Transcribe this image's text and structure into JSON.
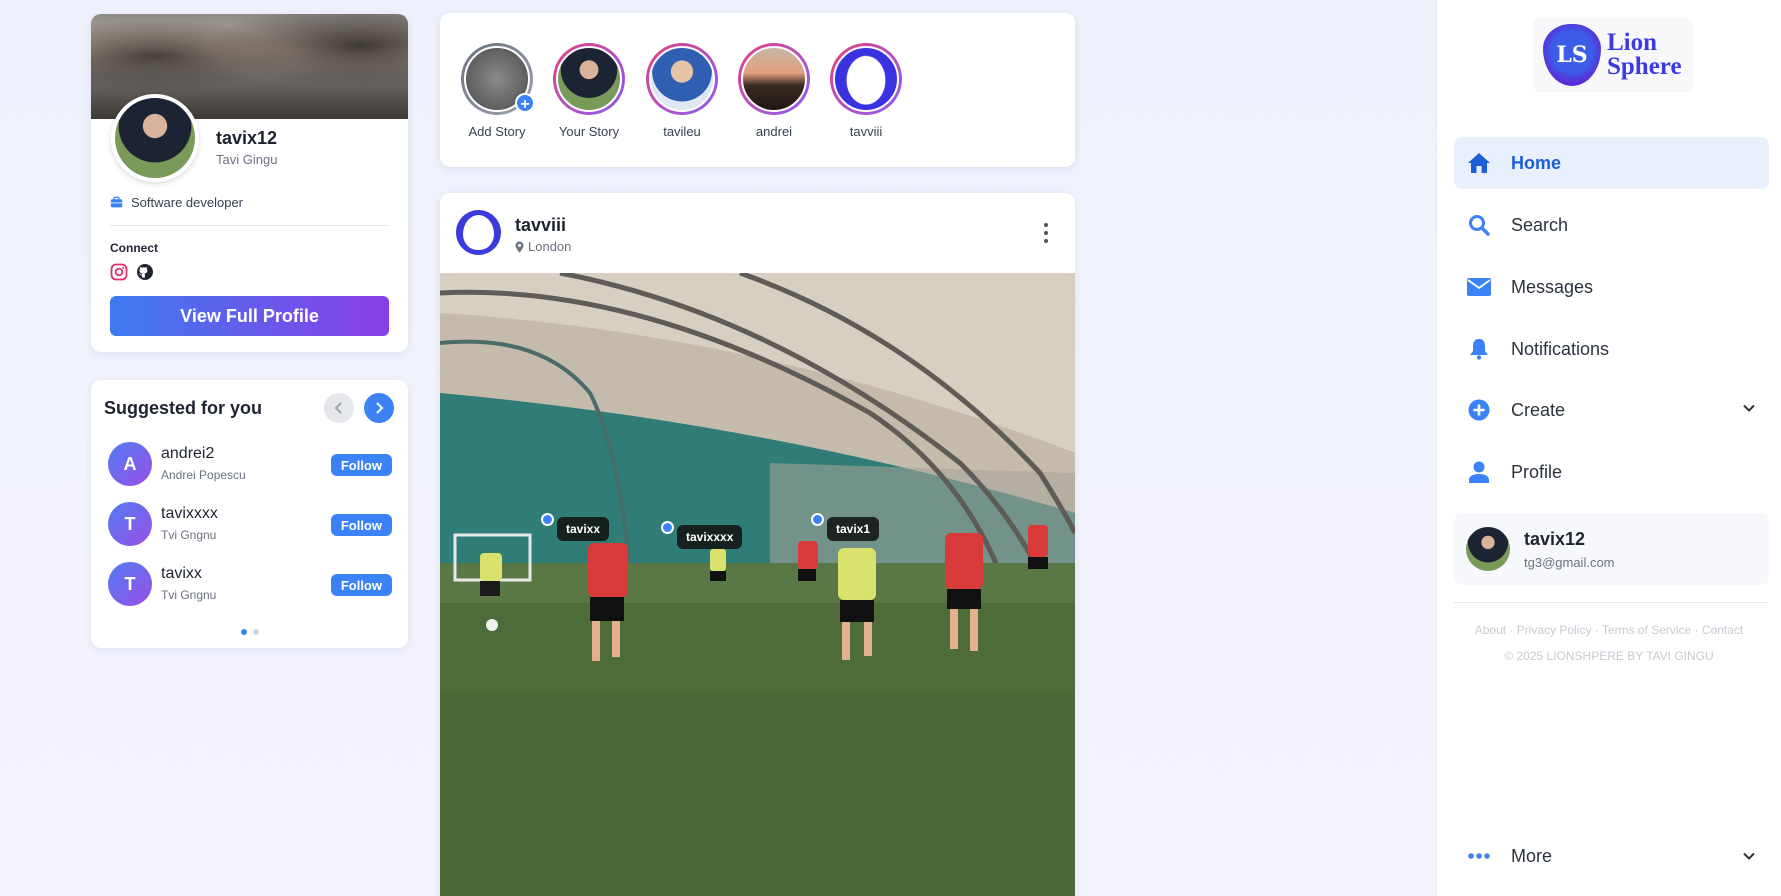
{
  "profile": {
    "username": "tavix12",
    "full_name": "Tavi Gingu",
    "job": "Software developer",
    "connect_label": "Connect",
    "view_button": "View Full Profile"
  },
  "suggested": {
    "title": "Suggested for you",
    "items": [
      {
        "initial": "A",
        "username": "andrei2",
        "name": "Andrei Popescu",
        "button": "Follow"
      },
      {
        "initial": "T",
        "username": "tavixxxx",
        "name": "Tvi Gngnu",
        "button": "Follow"
      },
      {
        "initial": "T",
        "username": "tavixx",
        "name": "Tvi Gngnu",
        "button": "Follow"
      }
    ]
  },
  "stories": [
    {
      "label": "Add Story"
    },
    {
      "label": "Your Story"
    },
    {
      "label": "tavileu"
    },
    {
      "label": "andrei"
    },
    {
      "label": "tavviii"
    }
  ],
  "post": {
    "username": "tavviii",
    "location": "London",
    "tags": [
      {
        "label": "tavixx"
      },
      {
        "label": "tavixxxx"
      },
      {
        "label": "tavix1"
      }
    ]
  },
  "sidebar": {
    "logo_line1": "Lion",
    "logo_line2": "Sphere",
    "logo_initials": "LS",
    "nav": [
      {
        "label": "Home",
        "icon": "home-icon"
      },
      {
        "label": "Search",
        "icon": "search-icon"
      },
      {
        "label": "Messages",
        "icon": "envelope-icon"
      },
      {
        "label": "Notifications",
        "icon": "bell-icon"
      },
      {
        "label": "Create",
        "icon": "plus-circle-icon"
      },
      {
        "label": "Profile",
        "icon": "user-icon"
      }
    ],
    "user": {
      "name": "tavix12",
      "email": "tg3@gmail.com"
    },
    "footer_links": "About · Privacy Policy · Terms of Service · Contact",
    "copyright": "© 2025 LIONSHPERE BY TAVI GINGU",
    "more": "More"
  },
  "colors": {
    "accent": "#3b82f6",
    "active_nav_bg": "#e8f0fe",
    "gradient_start": "#3e7bf0",
    "gradient_end": "#8a3ee8"
  }
}
